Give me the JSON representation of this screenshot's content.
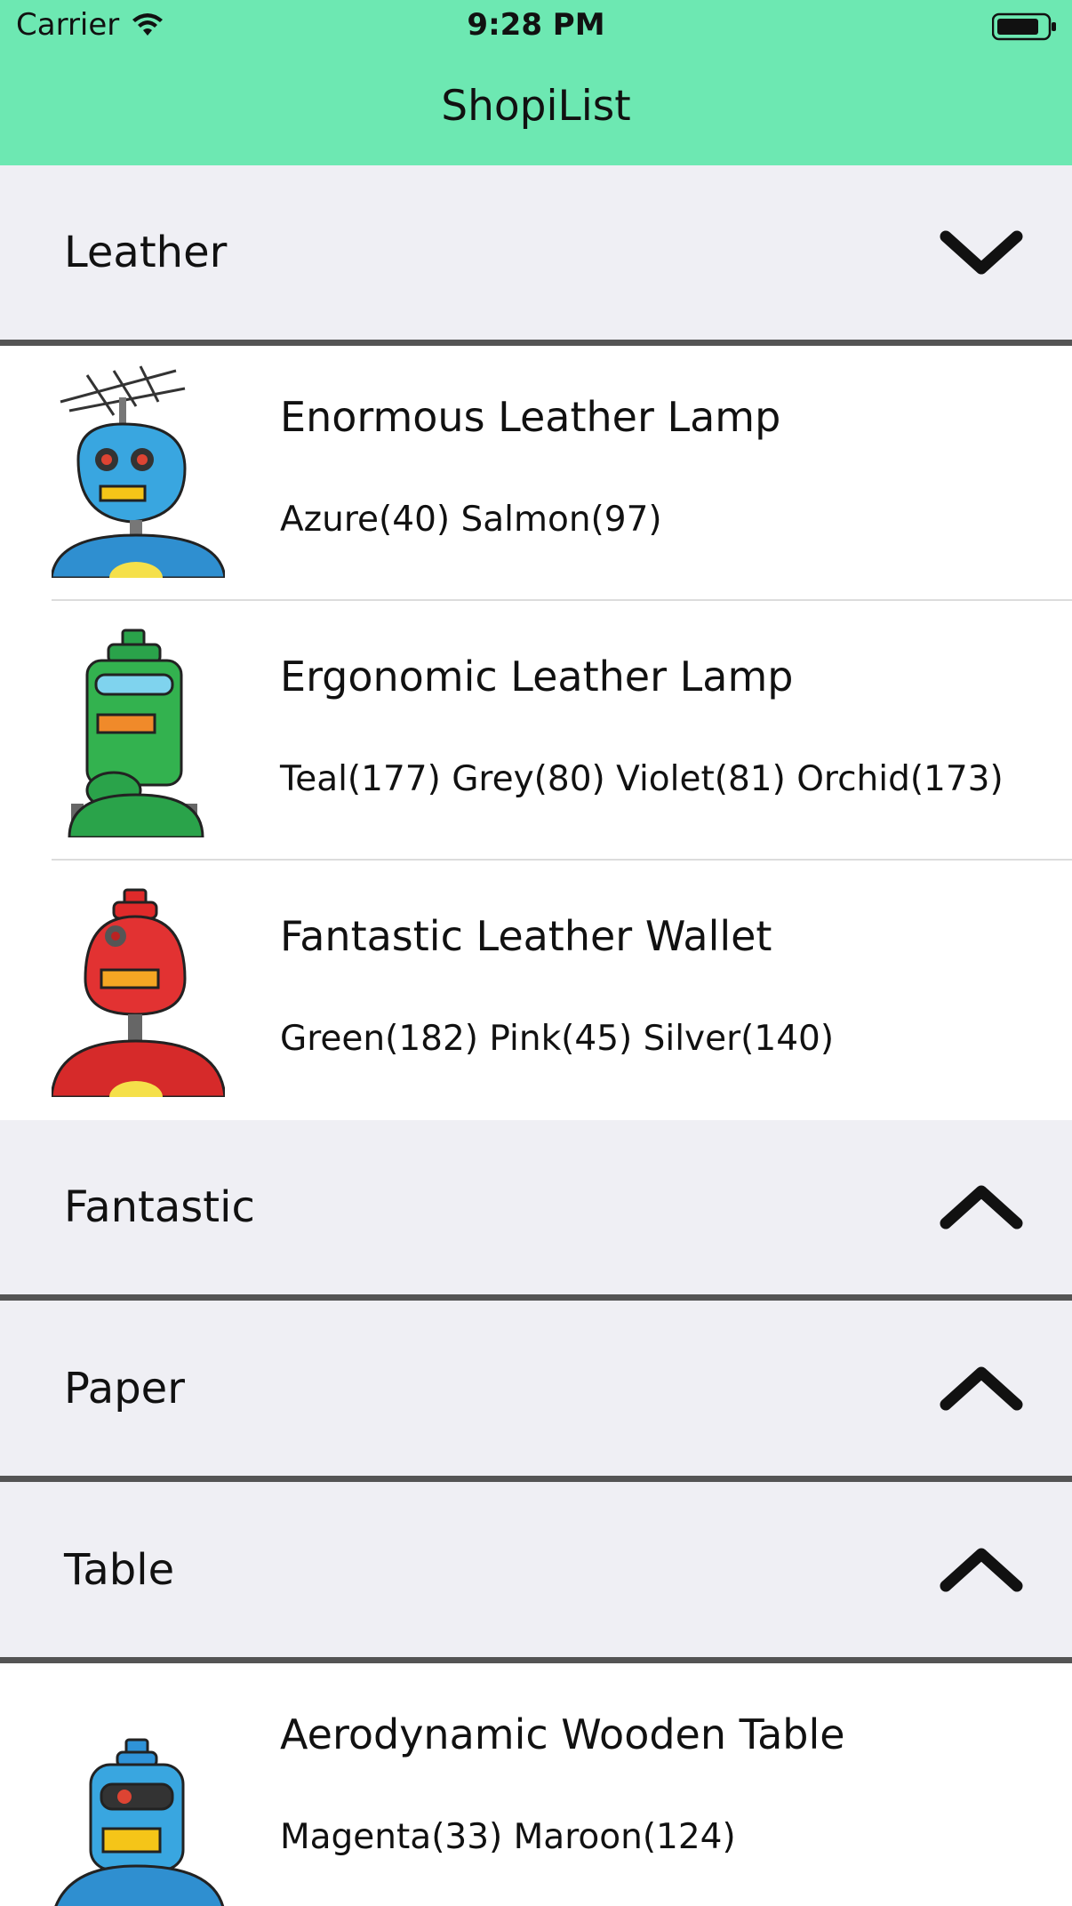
{
  "status_bar": {
    "carrier": "Carrier",
    "time": "9:28 PM"
  },
  "nav": {
    "title": "ShopiList"
  },
  "sections": [
    {
      "label": "Leather",
      "chevron": "chevron-down-icon",
      "items": [
        {
          "name": "Enormous Leather Lamp",
          "variants": "Azure(40)  Salmon(97)",
          "avatar": "blue-robot-antenna"
        },
        {
          "name": "Ergonomic Leather Lamp",
          "variants": "Teal(177)  Grey(80)  Violet(81)  Orchid(173)",
          "avatar": "green-robot"
        },
        {
          "name": "Fantastic Leather Wallet",
          "variants": "Green(182)  Pink(45)  Silver(140)",
          "avatar": "red-robot"
        }
      ]
    },
    {
      "label": "Fantastic",
      "chevron": "chevron-up-icon",
      "items": []
    },
    {
      "label": "Paper",
      "chevron": "chevron-up-icon",
      "items": []
    },
    {
      "label": "Table",
      "chevron": "chevron-up-icon",
      "items": [
        {
          "name": "Aerodynamic Wooden Table",
          "variants": "Magenta(33)  Maroon(124)",
          "avatar": "blue-robot-visor"
        }
      ]
    }
  ],
  "colors": {
    "nav_bg": "#6de8b2",
    "section_bg": "#efeff4",
    "separator": "#545454"
  }
}
